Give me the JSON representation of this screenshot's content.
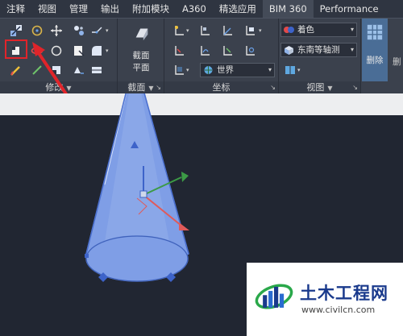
{
  "menu": {
    "items": [
      "注释",
      "视图",
      "管理",
      "输出",
      "附加模块",
      "A360",
      "精选应用",
      "BIM 360",
      "Performance"
    ]
  },
  "ribbon": {
    "panels": {
      "modify": "修改",
      "section": "截面",
      "coordinates": "坐标",
      "view": "视图"
    },
    "section_plane_button": {
      "line1": "截面",
      "line2": "平面"
    },
    "visual_style_combo": "着色",
    "view_direction_combo": "东南等轴测",
    "ucs_combo": "世界",
    "delete_button": "删除",
    "right_edge_char": "删"
  },
  "watermark": {
    "title": "土木工程网",
    "url": "www.civilcn.com"
  },
  "colors": {
    "highlight_box": "#e0242a",
    "arrow": "#e0242a",
    "cone_fill": "#7f9ee6",
    "axis_x": "#e05a5a",
    "axis_y": "#3c9a46",
    "axis_z": "#3d63c9",
    "brand_blue": "#1a3a8c"
  }
}
